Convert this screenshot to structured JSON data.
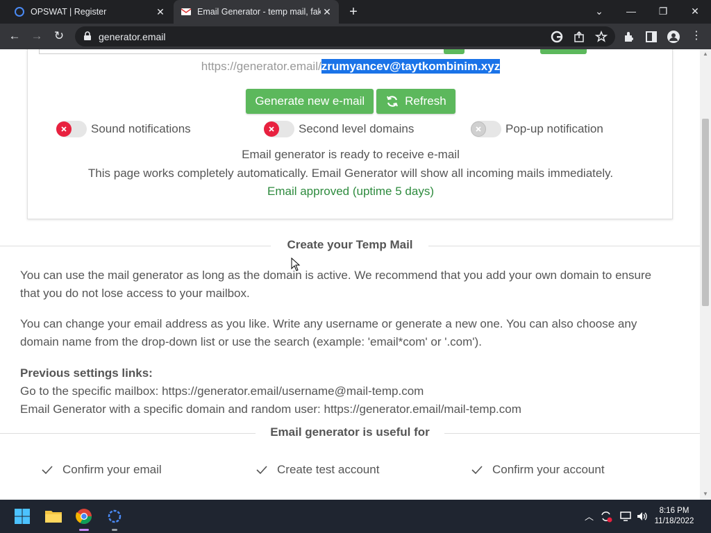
{
  "tabs": [
    {
      "title": "OPSWAT | Register",
      "active": false
    },
    {
      "title": "Email Generator - temp mail, fake",
      "active": true
    }
  ],
  "address_bar": {
    "url": "generator.email"
  },
  "card": {
    "email_prefix": "https://generator.email/",
    "email_address": "zrumyancev@taytkombinim.xyz",
    "generate_label": "Generate new e-mail",
    "refresh_label": "Refresh",
    "toggles": [
      {
        "label": "Sound notifications",
        "state": "off-red"
      },
      {
        "label": "Second level domains",
        "state": "off-red"
      },
      {
        "label": "Pop-up notification",
        "state": "off-grey"
      }
    ],
    "ready_text": "Email generator is ready to receive e-mail",
    "auto_text": "This page works completely automatically. Email Generator will show all incoming mails immediately.",
    "approved_text": "Email approved (uptime 5 days)"
  },
  "section1": {
    "heading": "Create your Temp Mail",
    "para1_line1": "You can use the mail generator as long as the domain is active. We recommend that you add your own domain to ensure",
    "para1_line2": "that you do not lose access to your mailbox.",
    "para2_line1": "You can change your email address as you like. Write any username or generate a new one. You can also choose any",
    "para2_line2": "domain name from the drop-down list or use the search (example: 'email*com' or '.com').",
    "prev_heading": "Previous settings links:",
    "prev_line1": "Go to the specific mailbox: https://generator.email/username@mail-temp.com",
    "prev_line2": "Email Generator with a specific domain and random user: https://generator.email/mail-temp.com"
  },
  "section2": {
    "heading": "Email generator is useful for",
    "items": [
      "Confirm your email",
      "Create test account",
      "Confirm your account"
    ]
  },
  "taskbar": {
    "time": "8:16 PM",
    "date": "11/18/2022"
  },
  "colors": {
    "green": "#5cb85c",
    "red_toggle": "#e8213f",
    "selection": "#1a73e8",
    "approved": "#2e8b3e"
  }
}
